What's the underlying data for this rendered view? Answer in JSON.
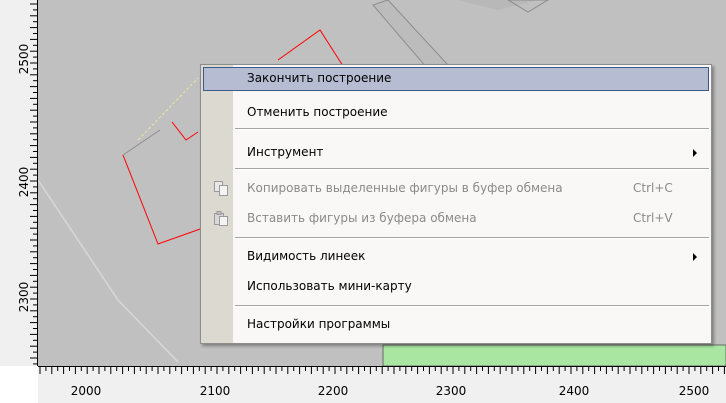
{
  "rulers": {
    "vertical": [
      {
        "label": "2500"
      },
      {
        "label": "2400"
      },
      {
        "label": "2300"
      }
    ],
    "horizontal": [
      {
        "label": "2000"
      },
      {
        "label": "2100"
      },
      {
        "label": "2200"
      },
      {
        "label": "2300"
      },
      {
        "label": "2400"
      },
      {
        "label": "2500"
      }
    ]
  },
  "context_menu": {
    "items": {
      "finish": {
        "label": "Закончить построение"
      },
      "cancel": {
        "label": "Отменить построение"
      },
      "tool": {
        "label": "Инструмент"
      },
      "copy": {
        "label": "Копировать выделенные фигуры в буфер обмена",
        "shortcut": "Ctrl+C",
        "icon": "copy-icon"
      },
      "paste": {
        "label": "Вставить фигуры из буфера обмена",
        "shortcut": "Ctrl+V",
        "icon": "paste-icon"
      },
      "rulers": {
        "label": "Видимость линеек"
      },
      "minimap": {
        "label": "Использовать мини-карту"
      },
      "settings": {
        "label": "Настройки программы"
      }
    }
  },
  "colors": {
    "map_background": "#c0c0c0",
    "highlight": "#b6bdd2",
    "shape_outline": "#ff0000",
    "green_area": "#a8e6a1"
  }
}
